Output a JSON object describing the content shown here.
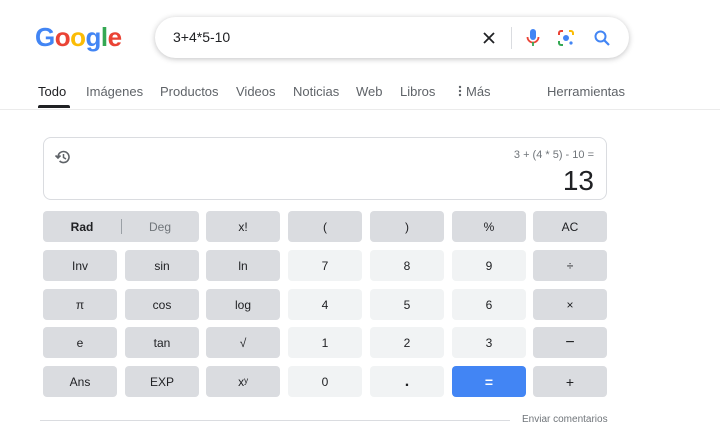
{
  "logo": {
    "letters": [
      "G",
      "o",
      "o",
      "g",
      "l",
      "e"
    ],
    "colors": [
      "#4285f4",
      "#ea4335",
      "#fbbc05",
      "#4285f4",
      "#34a853",
      "#ea4335"
    ]
  },
  "search": {
    "query": "3+4*5-10"
  },
  "tabs": [
    {
      "label": "Todo",
      "active": true
    },
    {
      "label": "Imágenes"
    },
    {
      "label": "Productos"
    },
    {
      "label": "Videos"
    },
    {
      "label": "Noticias"
    },
    {
      "label": "Web"
    },
    {
      "label": "Libros"
    },
    {
      "label": "Más"
    },
    {
      "label": "Herramientas"
    }
  ],
  "calculator": {
    "expression": "3 + (4 * 5) - 10 =",
    "result": "13",
    "rad": "Rad",
    "deg": "Deg",
    "keys": [
      {
        "label": "x!"
      },
      {
        "label": "("
      },
      {
        "label": ")"
      },
      {
        "label": "%"
      },
      {
        "label": "AC"
      },
      {
        "label": "Inv"
      },
      {
        "label": "sin"
      },
      {
        "label": "ln"
      },
      {
        "label": "7"
      },
      {
        "label": "8"
      },
      {
        "label": "9"
      },
      {
        "label": "÷"
      },
      {
        "label": "π"
      },
      {
        "label": "cos"
      },
      {
        "label": "log"
      },
      {
        "label": "4"
      },
      {
        "label": "5"
      },
      {
        "label": "6"
      },
      {
        "label": "×"
      },
      {
        "label": "e"
      },
      {
        "label": "tan"
      },
      {
        "label": "√"
      },
      {
        "label": "1"
      },
      {
        "label": "2"
      },
      {
        "label": "3"
      },
      {
        "label": "−"
      },
      {
        "label": "Ans"
      },
      {
        "label": "EXP"
      },
      {
        "label": "xʸ"
      },
      {
        "label": "0"
      },
      {
        "label": "."
      },
      {
        "label": "="
      },
      {
        "label": "+"
      }
    ]
  },
  "footer": {
    "feedback": "Enviar comentarios"
  },
  "colors": {
    "accent_blue": "#4285f4",
    "key_dark": "#dadce0",
    "key_light": "#f1f3f4"
  }
}
